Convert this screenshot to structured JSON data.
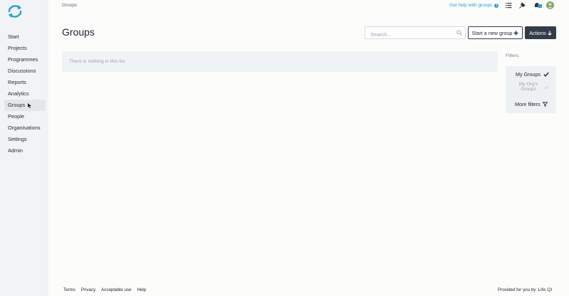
{
  "topbar": {
    "breadcrumb": "Groups",
    "help_link": "Get help with groups",
    "help_icon": "info-icon",
    "icons": [
      "list-icon",
      "pin-icon",
      "notifications-icon",
      "user-avatar"
    ]
  },
  "sidebar": {
    "logo": "refresh-logo-icon",
    "items": [
      {
        "label": "Start"
      },
      {
        "label": "Projects"
      },
      {
        "label": "Programmes"
      },
      {
        "label": "Discussions"
      },
      {
        "label": "Reports"
      },
      {
        "label": "Analytics"
      },
      {
        "label": "Groups"
      },
      {
        "label": "People"
      },
      {
        "label": "Organisations"
      },
      {
        "label": "Settings"
      },
      {
        "label": "Admin"
      }
    ],
    "active": "Groups"
  },
  "main": {
    "title": "Groups",
    "search_placeholder": "Search...",
    "new_group_button": "Start a new group",
    "actions_button": "Actions",
    "empty_message": "There is nothing in this list"
  },
  "filters": {
    "label": "Filters",
    "my_groups": "My Groups",
    "my_orgs_groups": "My Org's Groups",
    "more_filters": "More filters"
  },
  "footer": {
    "links": [
      "Terms",
      "Privacy",
      "Acceptable use",
      "Help"
    ],
    "provided_by": "Provided for you by",
    "brand": "Life QI"
  },
  "colors": {
    "accent": "#2aa0d8",
    "dark_button": "#333d49",
    "sidebar_bg": "#f1f3f5"
  }
}
